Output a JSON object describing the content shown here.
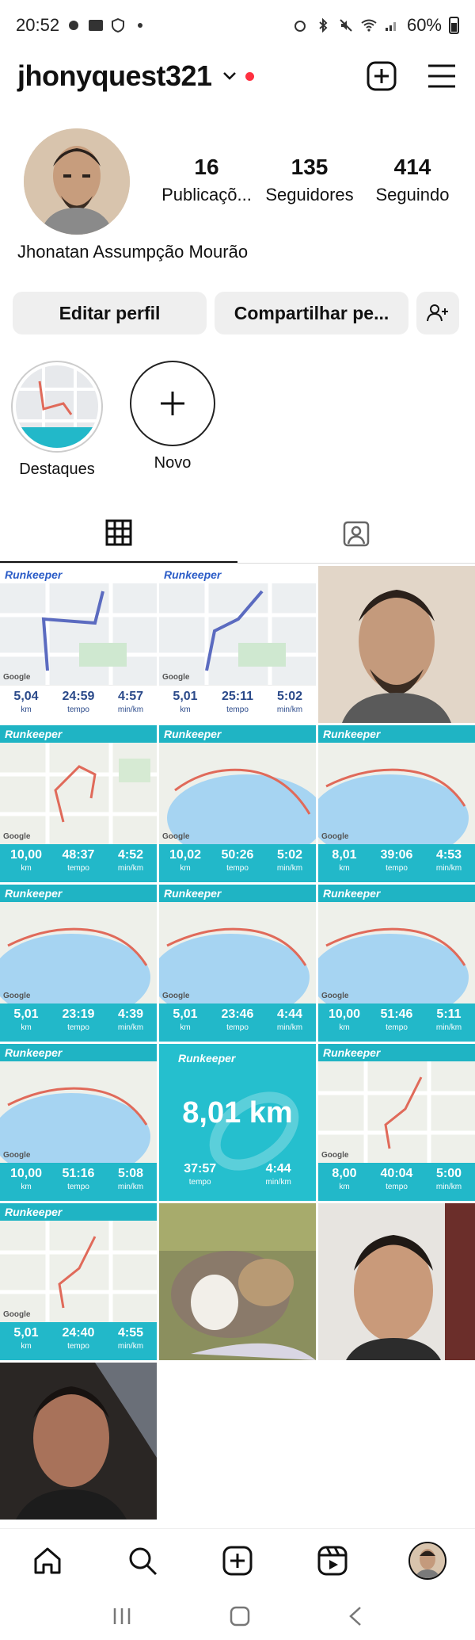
{
  "status_bar": {
    "time": "20:52",
    "battery": "60%"
  },
  "header": {
    "username": "jhonyquest321"
  },
  "profile": {
    "full_name": "Jhonatan Assumpção Mourão",
    "stats": [
      {
        "value": "16",
        "label": "Publicaçõ..."
      },
      {
        "value": "135",
        "label": "Seguidores"
      },
      {
        "value": "414",
        "label": "Seguindo"
      }
    ]
  },
  "actions": {
    "edit_label": "Editar perfil",
    "share_label": "Compartilhar pe..."
  },
  "highlights": [
    {
      "label": "Destaques"
    },
    {
      "label": "Novo"
    }
  ],
  "grid": {
    "brand": "Runkeeper",
    "posts": [
      {
        "type": "runkeeper-white",
        "km": "5,04",
        "time": "24:59",
        "pace": "4:57"
      },
      {
        "type": "runkeeper-white",
        "km": "5,01",
        "time": "25:11",
        "pace": "5:02"
      },
      {
        "type": "photo",
        "desc": "selfie"
      },
      {
        "type": "runkeeper-teal",
        "km": "10,00",
        "time": "48:37",
        "pace": "4:52"
      },
      {
        "type": "runkeeper-teal",
        "km": "10,02",
        "time": "50:26",
        "pace": "5:02"
      },
      {
        "type": "runkeeper-teal",
        "km": "8,01",
        "time": "39:06",
        "pace": "4:53"
      },
      {
        "type": "runkeeper-teal",
        "km": "5,01",
        "time": "23:19",
        "pace": "4:39"
      },
      {
        "type": "runkeeper-teal",
        "km": "5,01",
        "time": "23:46",
        "pace": "4:44"
      },
      {
        "type": "runkeeper-teal",
        "km": "10,00",
        "time": "51:46",
        "pace": "5:11"
      },
      {
        "type": "runkeeper-teal",
        "km": "10,00",
        "time": "51:16",
        "pace": "5:08"
      },
      {
        "type": "runkeeper-big",
        "km": "8,01 km",
        "time": "37:57",
        "pace": "4:44"
      },
      {
        "type": "runkeeper-teal",
        "km": "8,00",
        "time": "40:04",
        "pace": "5:00"
      },
      {
        "type": "runkeeper-teal",
        "km": "5,01",
        "time": "24:40",
        "pace": "4:55"
      },
      {
        "type": "photo",
        "desc": "cat"
      },
      {
        "type": "photo",
        "desc": "selfie"
      },
      {
        "type": "photo",
        "desc": "selfie-dark"
      }
    ],
    "unit_km": "km",
    "unit_time": "tempo",
    "unit_pace": "min/km"
  },
  "map_labels": {
    "google": "Google"
  },
  "colors": {
    "teal": "#22b8c9",
    "notification_dot": "#ff3040"
  }
}
